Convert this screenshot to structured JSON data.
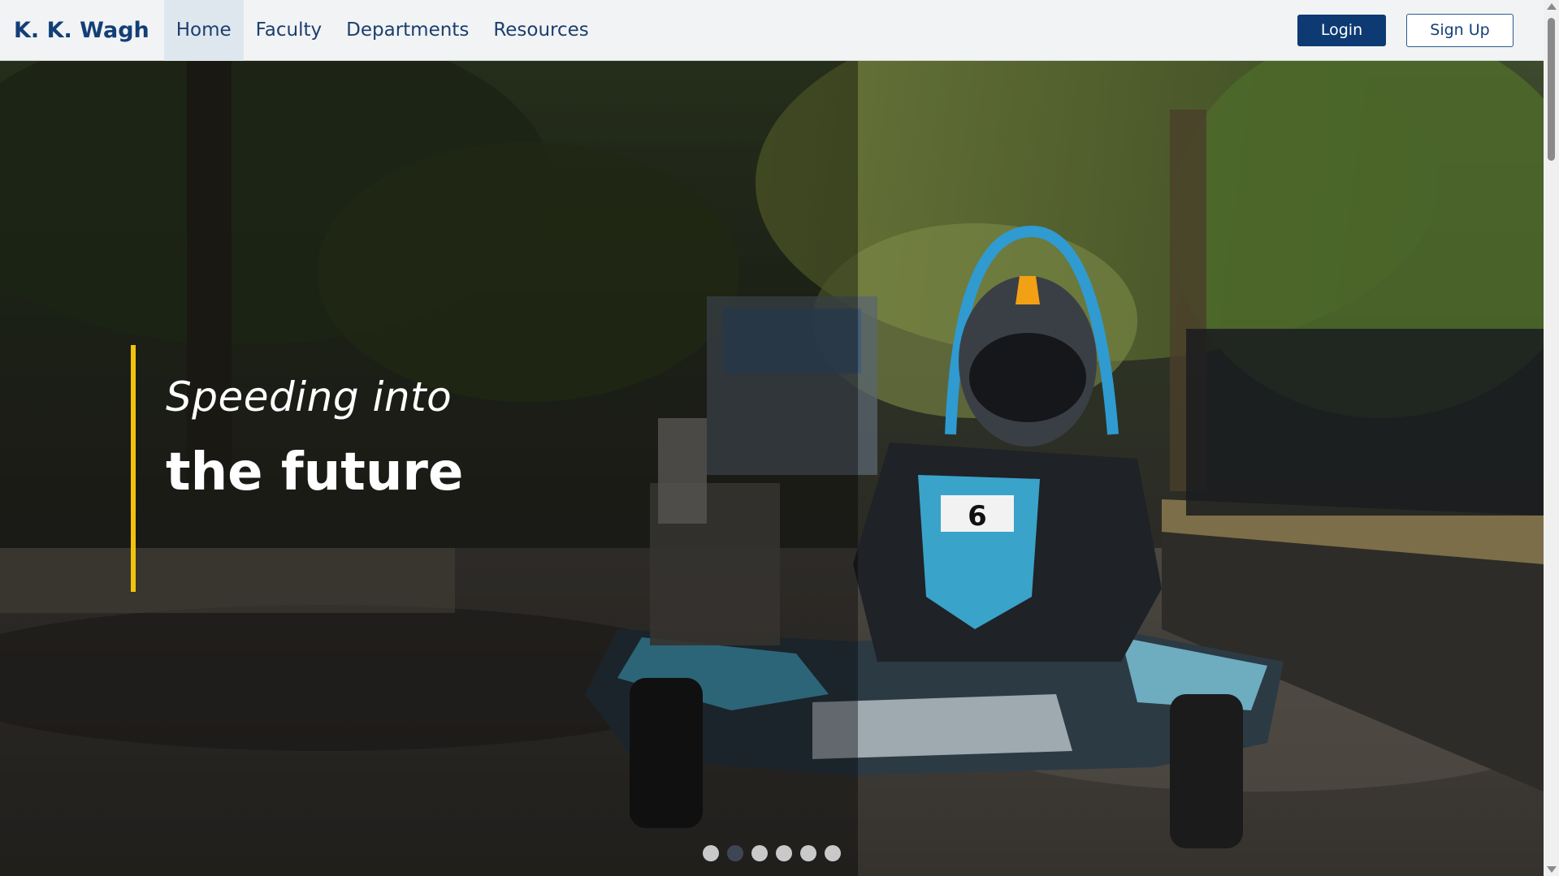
{
  "brand": {
    "name": "K. K. Wagh"
  },
  "nav": {
    "items": [
      {
        "label": "Home",
        "active": true
      },
      {
        "label": "Faculty",
        "active": false
      },
      {
        "label": "Departments",
        "active": false
      },
      {
        "label": "Resources",
        "active": false
      }
    ],
    "login_label": "Login",
    "signup_label": "Sign Up"
  },
  "hero": {
    "line1": "Speeding into",
    "line2": "the future",
    "kart_number": "6",
    "slide_count": 6,
    "active_slide": 2
  },
  "colors": {
    "brand": "#123f78",
    "primary_button": "#0d3a73",
    "accent": "#f4c20d",
    "active_dot": "#3e4656"
  }
}
